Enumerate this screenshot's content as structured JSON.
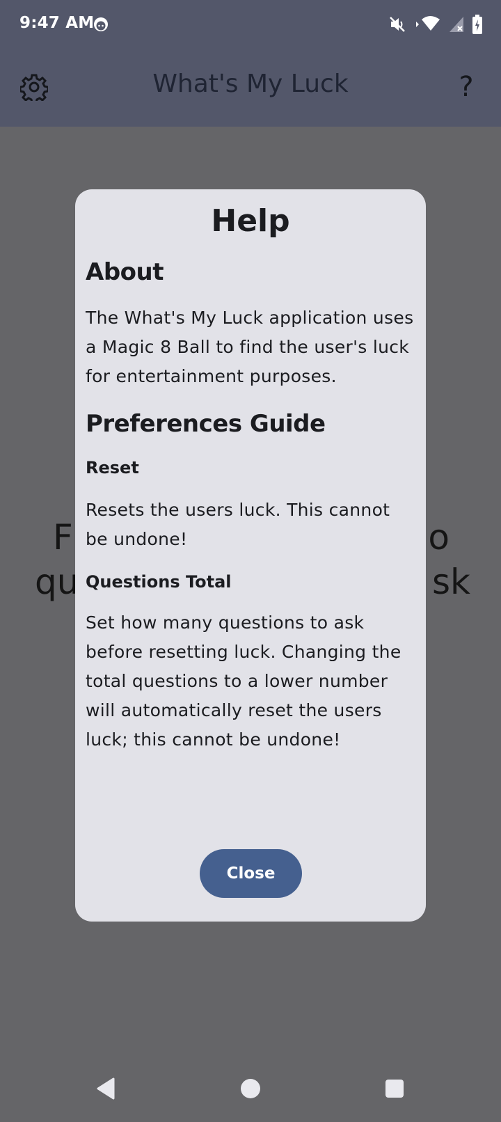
{
  "status_bar": {
    "time": "9:47 AM",
    "icons": [
      "notification-face-icon",
      "mute-icon",
      "wifi-icon",
      "signal-icon",
      "battery-icon"
    ]
  },
  "app_bar": {
    "title": "What's My Luck",
    "settings_icon": "gear-icon",
    "help_label": "?"
  },
  "background": {
    "prompt_line1_left": "F",
    "prompt_line1_right": "o",
    "prompt_line2_left": "qu",
    "prompt_line2_right": "sk"
  },
  "dialog": {
    "title": "Help",
    "about_heading": "About",
    "about_text": "The What's My Luck application uses a Magic 8 Ball to find the user's luck for entertainment purposes.",
    "preferences_heading": "Preferences Guide",
    "reset_heading": "Reset",
    "reset_text": "Resets the users luck. This cannot be undone!",
    "questions_heading": "Questions Total",
    "questions_text": "Set how many questions to ask before resetting luck. Changing the total questions to a lower number will automatically reset the users luck; this cannot be undone!",
    "close_label": "Close"
  },
  "nav_bar": {
    "icons": [
      "back-icon",
      "home-icon",
      "recents-icon"
    ]
  },
  "colors": {
    "scrim": "#656568",
    "app_bar": "#53576a",
    "dialog_bg": "#e2e2e8",
    "primary_button": "#45608f",
    "text": "#1b1c20"
  }
}
